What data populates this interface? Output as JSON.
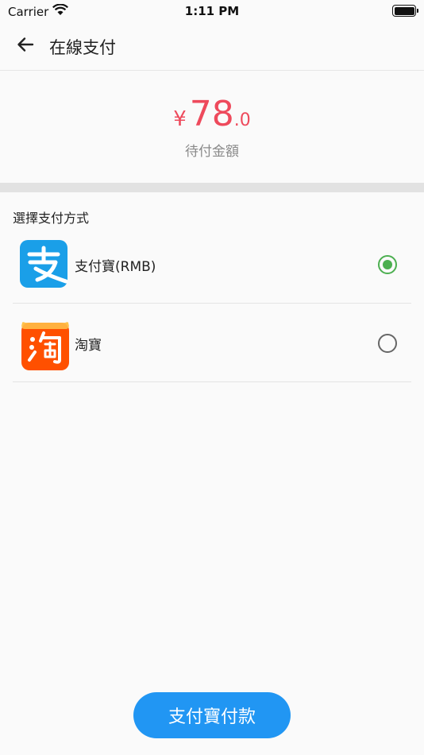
{
  "status_bar": {
    "carrier": "Carrier",
    "time": "1:11 PM"
  },
  "nav": {
    "title": "在線支付"
  },
  "amount": {
    "currency": "¥",
    "integer": "78",
    "decimal": ".0",
    "label": "待付金額",
    "color": "#ee4a5c"
  },
  "methods": {
    "title": "選擇支付方式",
    "items": [
      {
        "label": "支付寶(RMB)",
        "icon": "alipay-icon",
        "selected": true
      },
      {
        "label": "淘寶",
        "icon": "taobao-icon",
        "selected": false
      }
    ]
  },
  "pay_button": {
    "label": "支付寶付款",
    "color": "#2196f3"
  },
  "colors": {
    "selected_radio": "#4caf50",
    "alipay": "#1a9fe8",
    "taobao": "#ff5000"
  }
}
